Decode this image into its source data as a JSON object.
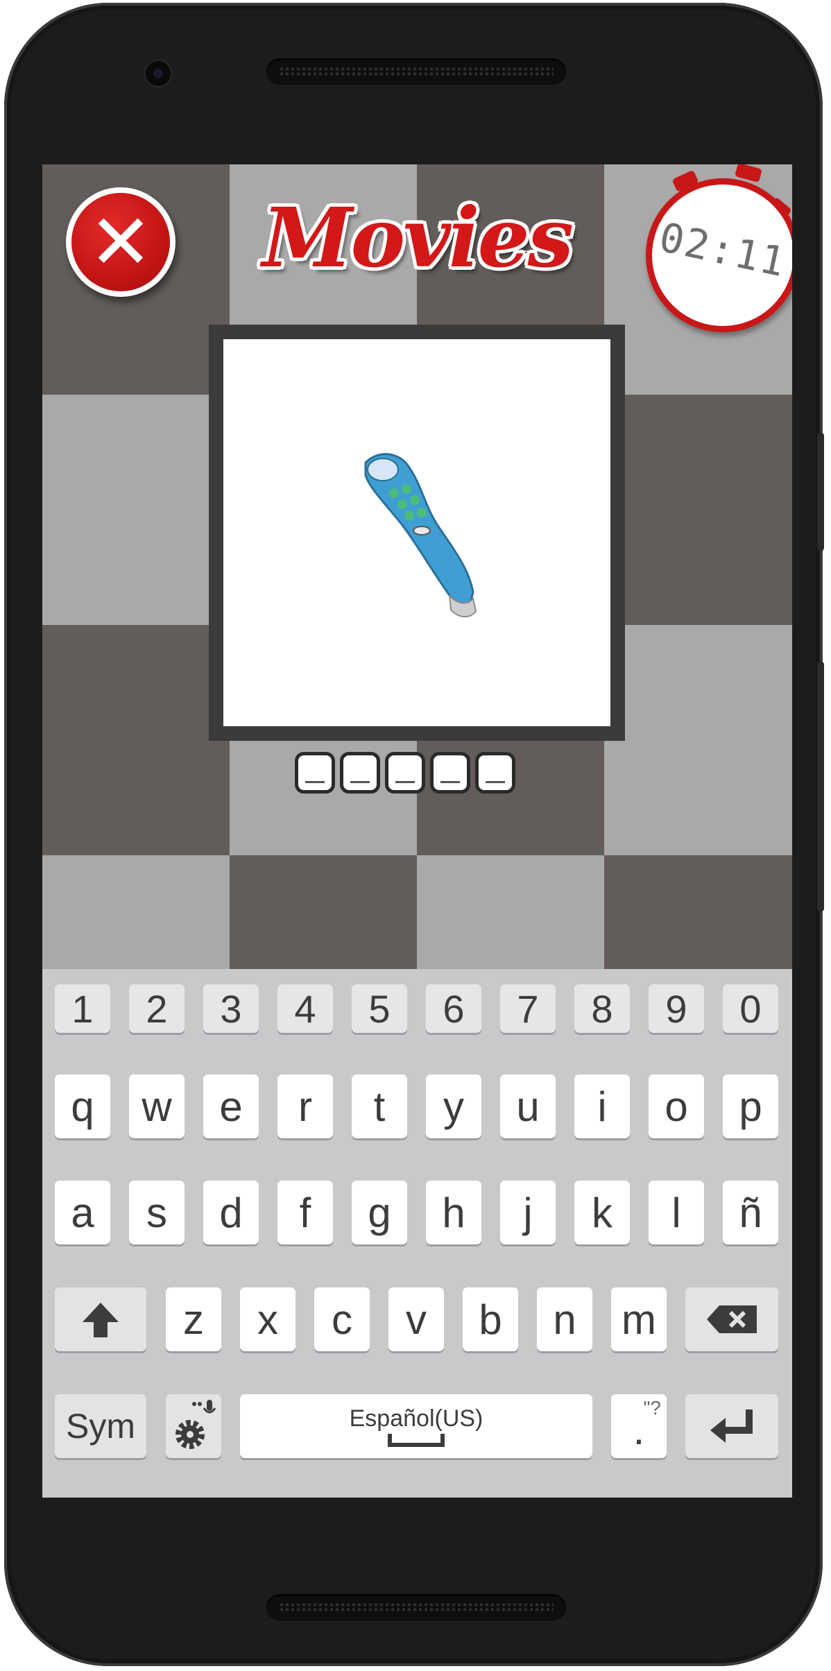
{
  "game": {
    "category_title": "Movies",
    "timer": "02:11",
    "answer_slots": 5,
    "close_icon": "close-icon",
    "colors": {
      "accent_red": "#c91717",
      "board_dark": "#625d5b",
      "board_light": "#a9a9a9"
    }
  },
  "keyboard": {
    "row_numbers": [
      "1",
      "2",
      "3",
      "4",
      "5",
      "6",
      "7",
      "8",
      "9",
      "0"
    ],
    "row_1": [
      "q",
      "w",
      "e",
      "r",
      "t",
      "y",
      "u",
      "i",
      "o",
      "p"
    ],
    "row_2": [
      "a",
      "s",
      "d",
      "f",
      "g",
      "h",
      "j",
      "k",
      "l",
      "ñ"
    ],
    "row_3": [
      "z",
      "x",
      "c",
      "v",
      "b",
      "n",
      "m"
    ],
    "shift_icon": "shift-arrow-icon",
    "backspace_icon": "backspace-icon",
    "sym_label": "Sym",
    "settings_icon": "gear-mic-icon",
    "space_label": "Español(US)",
    "punct_label": ".",
    "punct_hint": "\"?",
    "enter_icon": "enter-icon"
  }
}
